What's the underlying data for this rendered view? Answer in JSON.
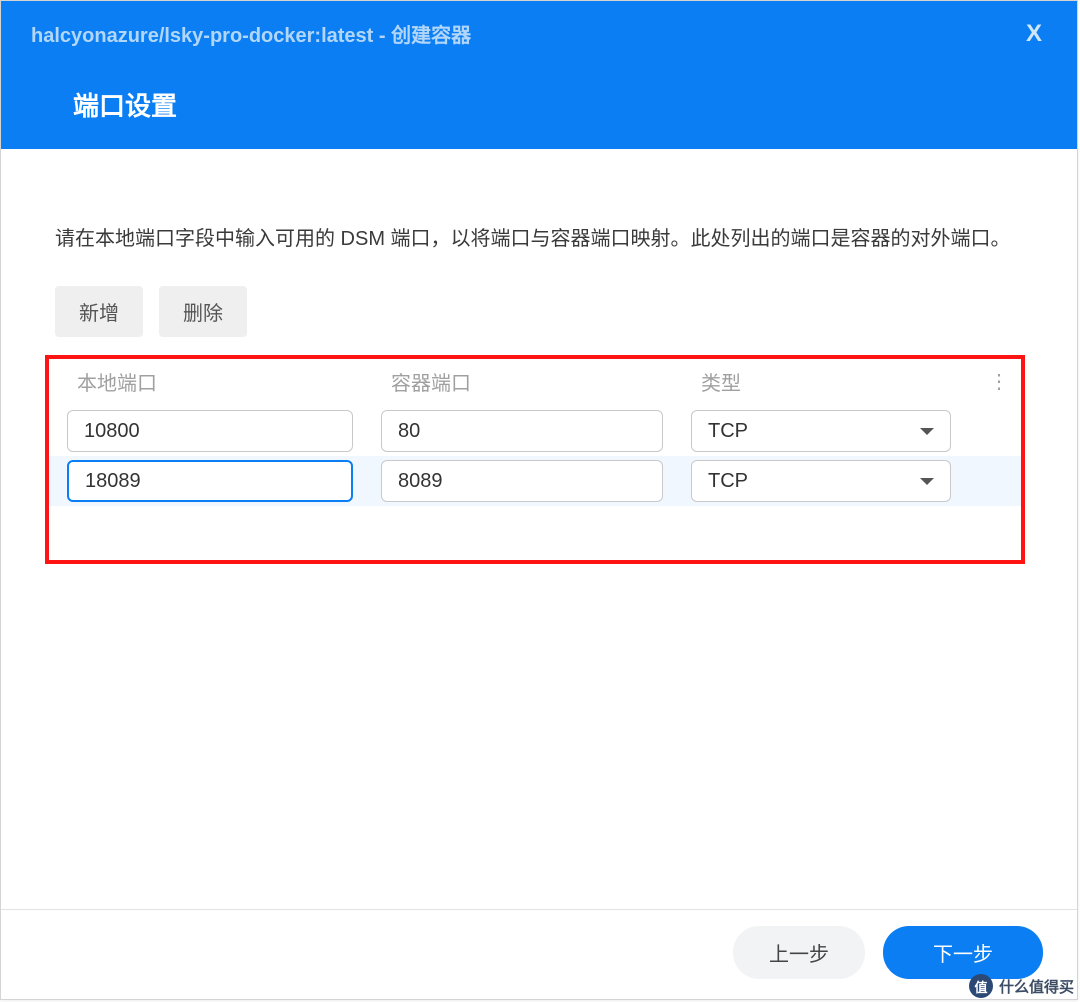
{
  "header": {
    "title": "halcyonazure/lsky-pro-docker:latest - 创建容器",
    "subtitle": "端口设置",
    "close_label": "X"
  },
  "body": {
    "description": "请在本地端口字段中输入可用的 DSM 端口，以将端口与容器端口映射。此处列出的端口是容器的对外端口。",
    "add_btn": "新增",
    "delete_btn": "删除"
  },
  "table": {
    "headers": {
      "local": "本地端口",
      "container": "容器端口",
      "type": "类型"
    },
    "rows": [
      {
        "local": "10800",
        "container": "80",
        "type": "TCP",
        "focused": false,
        "selected": false
      },
      {
        "local": "18089",
        "container": "8089",
        "type": "TCP",
        "focused": true,
        "selected": true
      }
    ]
  },
  "footer": {
    "prev": "上一步",
    "next": "下一步"
  },
  "watermark": {
    "badge": "值",
    "text": "什么值得买"
  }
}
